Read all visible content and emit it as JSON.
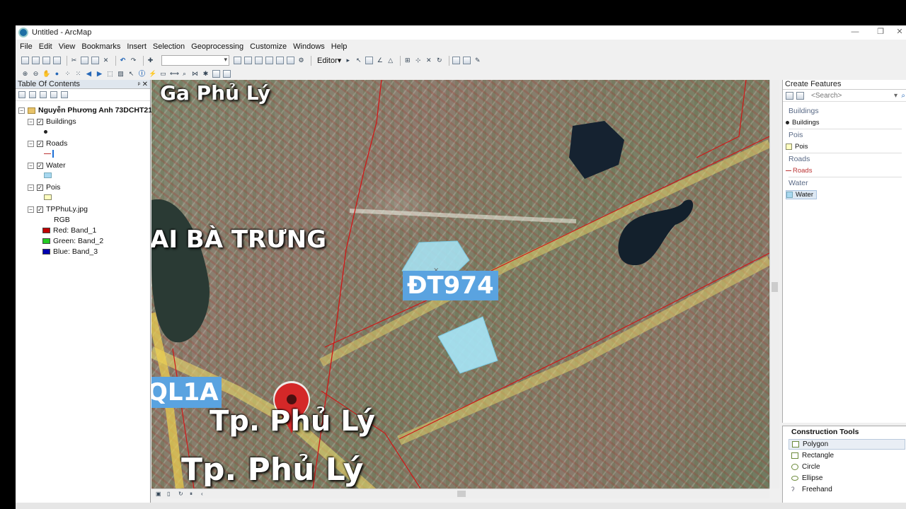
{
  "window": {
    "title": "Untitled - ArcMap",
    "min_label": "—",
    "max_label": "❐",
    "close_label": "✕"
  },
  "menu": [
    "File",
    "Edit",
    "View",
    "Bookmarks",
    "Insert",
    "Selection",
    "Geoprocessing",
    "Customize",
    "Windows",
    "Help"
  ],
  "toolbar": {
    "editor_label": "Editor▾"
  },
  "toc": {
    "title": "Table Of Contents",
    "map_name": "Nguyễn Phương Anh 73DCHT21",
    "layers": [
      {
        "name": "Buildings",
        "checked": true
      },
      {
        "name": "Roads",
        "checked": true
      },
      {
        "name": "Water",
        "checked": true
      },
      {
        "name": "Pois",
        "checked": true
      },
      {
        "name": "TPPhuLy.jpg",
        "checked": true
      }
    ],
    "raster": {
      "label": "RGB",
      "red": "Red:   Band_1",
      "green": "Green: Band_2",
      "blue": "Blue:  Band_3"
    },
    "colors": {
      "red": "#c00000",
      "green": "#22cc22",
      "blue": "#0000b0",
      "water": "#a8d8f0",
      "pois": "#ffffc0"
    }
  },
  "map": {
    "labels": {
      "ga_phu_ly": "Ga Phủ Lý",
      "hai_ba_trung": "AI BÀ TRƯNG",
      "dt974": "ĐT974",
      "ql1a": "QL1A",
      "tp_phu_ly_1": "Tp. Phủ Lý",
      "tp_phu_ly_2": "Tp. Phủ Lý"
    },
    "colors": {
      "water_fill": "#a6e4f5",
      "road_line": "#d01818",
      "road_highlight": "#f5e27a"
    }
  },
  "create_features": {
    "title": "Create Features",
    "search_placeholder": "<Search>",
    "groups": [
      {
        "name": "Buildings",
        "template": "Buildings"
      },
      {
        "name": "Pois",
        "template": "Pois"
      },
      {
        "name": "Roads",
        "template": "Roads"
      },
      {
        "name": "Water",
        "template": "Water"
      }
    ]
  },
  "construction_tools": {
    "title": "Construction Tools",
    "items": [
      "Polygon",
      "Rectangle",
      "Circle",
      "Ellipse",
      "Freehand"
    ]
  }
}
